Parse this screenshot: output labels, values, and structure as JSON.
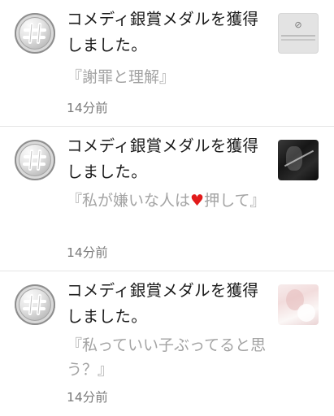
{
  "notifications": [
    {
      "title": "コメディ銀賞メダルを獲得しました。",
      "quote": "『謝罪と理解』",
      "time": "14分前",
      "thumbnail": "blocked-image"
    },
    {
      "title": "コメディ銀賞メダルを獲得しました。",
      "quote_before": "『私が嫌いな人は",
      "quote_heart": "♥",
      "quote_after": "押して』",
      "time": "14分前",
      "thumbnail": "dark-photo"
    },
    {
      "title": "コメディ銀賞メダルを獲得しました。",
      "quote": "『私っていい子ぶってると思う？』",
      "time": "14分前",
      "thumbnail": "soft-pink-photo"
    }
  ],
  "colors": {
    "title": "#1a1a1a",
    "quote": "#a3a3a3",
    "time": "#7a7a7a",
    "heart": "#e21b1b",
    "divider": "#e6e6e6"
  },
  "icons": {
    "medal": "silver-hash-medal-icon"
  }
}
